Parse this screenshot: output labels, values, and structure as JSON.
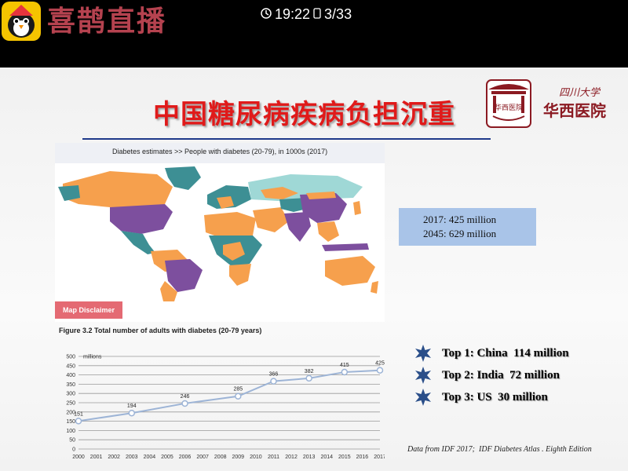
{
  "app": {
    "name": "喜鹊直播",
    "time": "19:22",
    "page": "3/33"
  },
  "slide": {
    "title": "中国糖尿病疾病负担沉重",
    "hospital": {
      "line1": "四川大学",
      "line2": "华西医院",
      "seal": "华西医院"
    },
    "map": {
      "caption": "Diabetes estimates >>  People with diabetes (20-79), in 1000s (2017)",
      "disclaimer": "Map Disclaimer",
      "colors": {
        "ocean": "#ffffff",
        "orange": "#f6a04d",
        "purple": "#7d4f9e",
        "teal": "#3d8f94",
        "lightteal": "#9fd8d6",
        "green": "#8fc58a"
      }
    },
    "estimates": {
      "line1": "2017: 425 million",
      "line2": "2045: 629 million"
    },
    "figure_caption": "Figure 3.2 Total number of adults with diabetes (20-79 years)",
    "top": [
      "Top 1: China  114 million",
      "Top 2: India  72 million",
      "Top 3: US  30 million"
    ],
    "source": "Data from IDF 2017;  IDF Diabetes Atlas . Eighth Edition"
  },
  "chart_data": {
    "type": "line",
    "title": "Figure 3.2 Total number of adults with diabetes (20-79 years)",
    "ylabel": "millions",
    "ylim": [
      0,
      500
    ],
    "yticks": [
      0,
      50,
      100,
      150,
      200,
      250,
      300,
      350,
      400,
      450,
      500
    ],
    "xticks": [
      2000,
      2001,
      2002,
      2003,
      2004,
      2005,
      2006,
      2007,
      2008,
      2009,
      2010,
      2011,
      2012,
      2013,
      2014,
      2015,
      2016,
      2017
    ],
    "grid": true,
    "series": [
      {
        "x": [
          2000,
          2003,
          2006,
          2009,
          2011,
          2013,
          2015,
          2017
        ],
        "values": [
          151,
          194,
          246,
          285,
          366,
          382,
          415,
          425
        ],
        "color": "#9db4d6"
      }
    ]
  }
}
